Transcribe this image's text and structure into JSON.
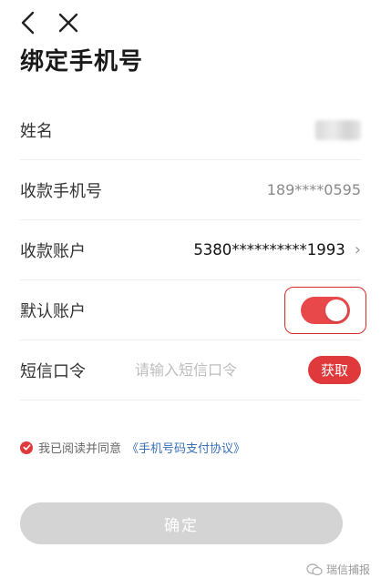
{
  "nav": {
    "back_icon": "chevron-left-icon",
    "close_icon": "close-icon"
  },
  "page": {
    "title": "绑定手机号"
  },
  "form": {
    "name": {
      "label": "姓名"
    },
    "phone": {
      "label": "收款手机号",
      "value": "189****0595"
    },
    "account": {
      "label": "收款账户",
      "value": "5380**********1993",
      "chevron": "›"
    },
    "default": {
      "label": "默认账户",
      "enabled": true
    },
    "sms": {
      "label": "短信口令",
      "placeholder": "请输入短信口令",
      "button_label": "获取"
    }
  },
  "agreement": {
    "text": "我已阅读并同意",
    "link": "《手机号码支付协议》",
    "checked": true
  },
  "confirm": {
    "label": "确定"
  },
  "watermark": {
    "text": "瑞信捕报"
  },
  "colors": {
    "accent": "#e0393c",
    "link": "#3b6fb6",
    "disabled": "#d4d4d4"
  }
}
